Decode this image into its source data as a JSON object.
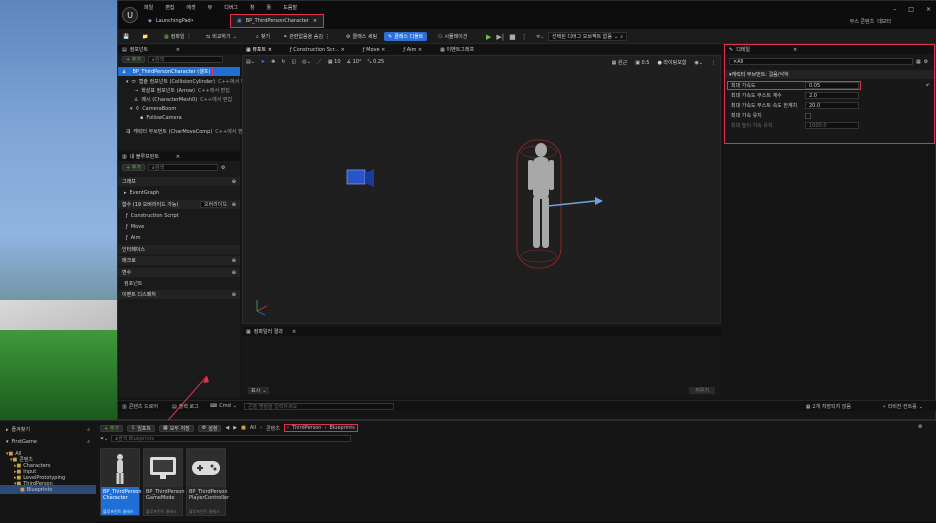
{
  "window": {
    "menu": [
      "파일",
      "편집",
      "에셋",
      "뷰",
      "디버그",
      "창",
      "툴",
      "도움말"
    ],
    "tab_launchpad": "LaunchingPad•",
    "tab_active": "BP_ThirdPersonCharacter",
    "source_control": "부스 콘텐츠",
    "source_control_user": "데모터"
  },
  "toolbar": {
    "compile": "컴파일",
    "diff": "비교하기",
    "find": "찾기",
    "hide_unrelated": "관련없음을 숨김",
    "class_settings": "클래스 세팅",
    "class_defaults": "클래스 디폴트",
    "simulation": "시뮬레이션",
    "debug_object": "선택된 디버그 오브젝트 없음"
  },
  "components_panel": {
    "title": "컴포넌트",
    "add": "+ 추가",
    "search_placeholder": "검색",
    "root": "BP_ThirdPersonCharacter (셀프)",
    "items": [
      "캡슐 컴포넌트 (CollisionCylinder)",
      "화살표 컴포넌트 (Arrow)",
      "메시 (CharacterMesh0)",
      "CameraBoom",
      "FollowCamera",
      "캐릭터 무브먼트 (CharMoveComp)"
    ],
    "edit_links": [
      "C++에서 편집",
      "C++에서 편집",
      "C++에서 편집",
      "C++에서 편집"
    ]
  },
  "my_blueprint": {
    "title": "내 블루프린트",
    "add": "+ 추가",
    "search_placeholder": "검색",
    "sections": [
      "그래프",
      "함수 (19 오버라이드 가능)",
      "매크로",
      "변수",
      "이벤트 디스패처",
      "인터페이스",
      "컴포넌트",
      "디스패처"
    ],
    "graph_items": [
      "EventGraph"
    ],
    "override_label": "오버라이드",
    "function_items": [
      "Construction Script",
      "Move",
      "Aim"
    ]
  },
  "graph_tabs": [
    "뷰포트",
    "Construction Scr...",
    "Move",
    "Aim",
    "이벤트그래프"
  ],
  "viewport": {
    "perspective": "원근",
    "lit": "라이팅포함",
    "snap_grid": "10",
    "snap_rot": "10°",
    "snap_scale": "0.25",
    "camera_speed": "0.5"
  },
  "compiler": {
    "title": "컴파일러 결과",
    "show": "표시",
    "clear": "지우기"
  },
  "details": {
    "title": "디테일",
    "search": "All",
    "section": "캐릭터 무브먼트: 걸음/낙하",
    "props": [
      {
        "label": "최대 가속도",
        "value": "0.05"
      },
      {
        "label": "최대 가속도 부스트 계수",
        "value": "2.0"
      },
      {
        "label": "최대 가속도 부스트 속도 한계치",
        "value": "20.0"
      },
      {
        "label": "최대 가속 유지",
        "value": ""
      },
      {
        "label": "최대 높이 가속 유지",
        "value": "1000.0"
      }
    ]
  },
  "status_bar": {
    "content_drawer": "콘텐츠 드로어",
    "output_log": "출력 로그",
    "cmd": "Cmd",
    "console_placeholder": "콘솔 명령을 입력하세요",
    "unsaved": "2개 저장되지 않음",
    "revision": "리비전 컨트롤"
  },
  "content_browser": {
    "favorites": "즐겨찾기",
    "project": "FirstGame",
    "add": "+ 추가",
    "import": "임포트",
    "save_all": "모두 저장",
    "settings_label": "설정",
    "breadcrumb": [
      "All",
      "콘텐츠",
      "ThirdPerson",
      "Blueprints"
    ],
    "search_placeholder": "검색 Blueprints",
    "tree": [
      "All",
      "콘텐츠",
      "Characters",
      "Input",
      "LevelPrototyping",
      "ThirdPerson",
      "Blueprints"
    ],
    "assets": [
      {
        "name": "BP_ThirdPerson Character",
        "type": "블루프린트 클래스"
      },
      {
        "name": "BP_ThirdPerson GameMode",
        "type": "블루프린트 클래스"
      },
      {
        "name": "BP_ThirdPerson PlayerController",
        "type": "블루프린트 클래스"
      }
    ]
  },
  "colors": {
    "accent_red": "#e2334b",
    "accent_blue": "#2d6fd6",
    "selection": "#1f6fd6"
  }
}
